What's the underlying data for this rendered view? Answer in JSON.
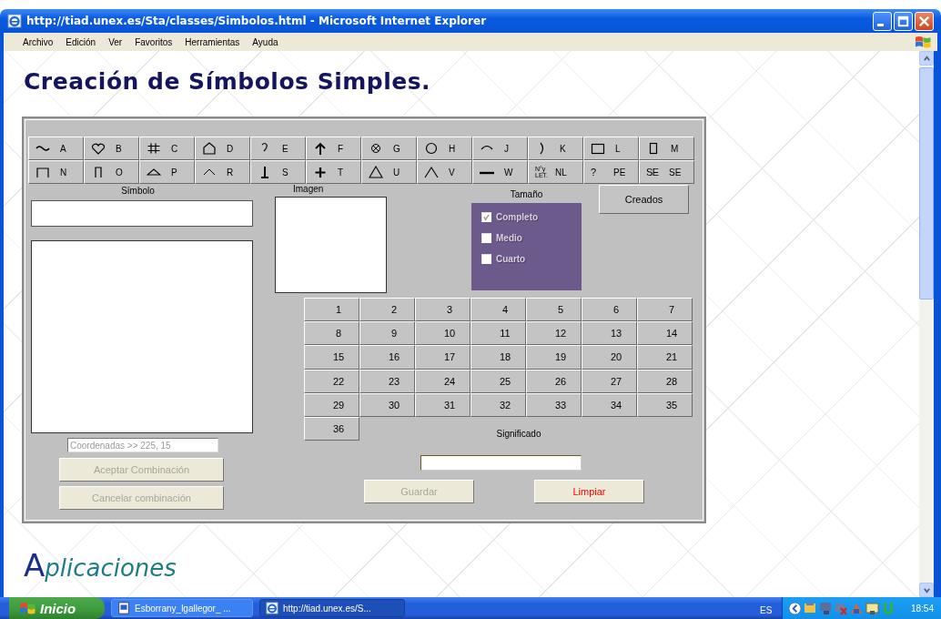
{
  "window": {
    "title": "http://tiad.unex.es/Sta/classes/Simbolos.html - Microsoft Internet Explorer"
  },
  "menu": [
    "Archivo",
    "Edición",
    "Ver",
    "Favoritos",
    "Herramientas",
    "Ayuda"
  ],
  "page": {
    "heading": "Creación de Símbolos Simples.",
    "footer_heading": "Aplicaciones"
  },
  "applet": {
    "symbols": [
      {
        "kind": "wave",
        "label": "A"
      },
      {
        "kind": "heart",
        "label": "B"
      },
      {
        "kind": "hash",
        "label": "C"
      },
      {
        "kind": "house",
        "label": "D"
      },
      {
        "kind": "hook",
        "label": "E"
      },
      {
        "kind": "arrow",
        "label": "F"
      },
      {
        "kind": "circlex",
        "label": "G"
      },
      {
        "kind": "circle",
        "label": "H"
      },
      {
        "kind": "arc",
        "label": "J"
      },
      {
        "kind": "paren",
        "label": "K"
      },
      {
        "kind": "square",
        "label": "L"
      },
      {
        "kind": "tall",
        "label": "M"
      },
      {
        "kind": "wideu",
        "label": "N"
      },
      {
        "kind": "narrowu",
        "label": "O"
      },
      {
        "kind": "flattri",
        "label": "P"
      },
      {
        "kind": "caret",
        "label": "R"
      },
      {
        "kind": "perp",
        "label": "S"
      },
      {
        "kind": "plus",
        "label": "T"
      },
      {
        "kind": "triangle",
        "label": "U"
      },
      {
        "kind": "wedge",
        "label": "V"
      },
      {
        "kind": "dash",
        "label": "W"
      },
      {
        "kind": "stacked",
        "glyph": "N°y LET.",
        "label": "NL"
      },
      {
        "kind": "text",
        "glyph": "?",
        "label": "PE"
      },
      {
        "kind": "text",
        "glyph": "SE",
        "label": "SE"
      }
    ],
    "simbolo_label": "Símbolo",
    "imagen_label": "Imagen",
    "tamano": {
      "label": "Tamaño",
      "options": [
        {
          "label": "Completo",
          "checked": true
        },
        {
          "label": "Medio",
          "checked": false
        },
        {
          "label": "Cuarto",
          "checked": false
        }
      ]
    },
    "creados_button": "Creados",
    "numbers": [
      "1",
      "2",
      "3",
      "4",
      "5",
      "6",
      "7",
      "8",
      "9",
      "10",
      "11",
      "12",
      "13",
      "14",
      "15",
      "16",
      "17",
      "18",
      "19",
      "20",
      "21",
      "22",
      "23",
      "24",
      "25",
      "26",
      "27",
      "28",
      "29",
      "30",
      "31",
      "32",
      "33",
      "34",
      "35",
      "36"
    ],
    "coordinates": "Coordenadas >> 225, 15",
    "combination_buttons": [
      {
        "label": "Aceptar Combinación",
        "disabled": true
      },
      {
        "label": "Cancelar combinación",
        "disabled": true
      }
    ],
    "significado_label": "Significado",
    "action_buttons": [
      {
        "label": "Guardar",
        "disabled": true
      },
      {
        "label": "Limpiar",
        "disabled": false,
        "color": "#ff0000"
      }
    ]
  },
  "taskbar": {
    "start": "Inicio",
    "tasks": [
      {
        "label": "Esborrany_lgallegor_ ...",
        "selected": false
      },
      {
        "label": "http://tiad.unex.es/S...",
        "selected": true
      }
    ],
    "language": "ES",
    "clock": "18:54"
  }
}
